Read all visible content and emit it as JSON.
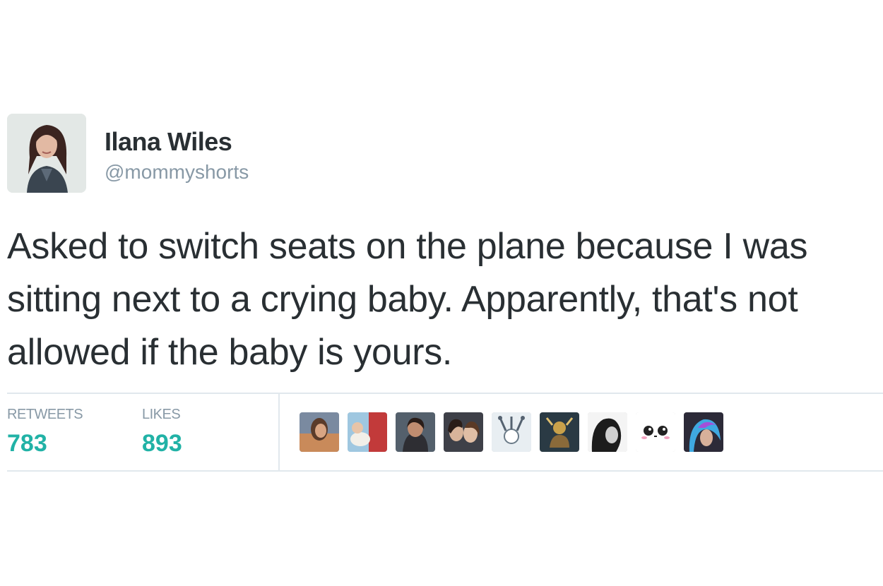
{
  "tweet": {
    "author_name": "Ilana Wiles",
    "handle": "@mommyshorts",
    "text": "Asked to switch seats on the plane because I was sitting next to a crying baby. Apparently, that's not allowed if the baby is yours."
  },
  "stats": {
    "retweets_label": "RETWEETS",
    "retweets_value": "783",
    "likes_label": "LIKES",
    "likes_value": "893"
  },
  "colors": {
    "count_accent": "#21b2a6",
    "muted_text": "#8899a6",
    "body_text": "#292f33",
    "divider": "#e1e8ed"
  }
}
